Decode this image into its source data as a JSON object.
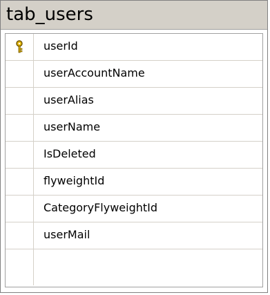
{
  "table": {
    "title": "tab_users",
    "columns": [
      {
        "name": "userId",
        "primary_key": true
      },
      {
        "name": "userAccountName",
        "primary_key": false
      },
      {
        "name": "userAlias",
        "primary_key": false
      },
      {
        "name": "userName",
        "primary_key": false
      },
      {
        "name": "IsDeleted",
        "primary_key": false
      },
      {
        "name": "flyweightId",
        "primary_key": false
      },
      {
        "name": "CategoryFlyweightId",
        "primary_key": false
      },
      {
        "name": "userMail",
        "primary_key": false
      }
    ],
    "key_icon": "primary-key-icon",
    "colors": {
      "title_bar": "#d4d0c8",
      "border": "#808080",
      "grid_line": "#d4d0c8",
      "key_gold": "#e6b800"
    }
  }
}
